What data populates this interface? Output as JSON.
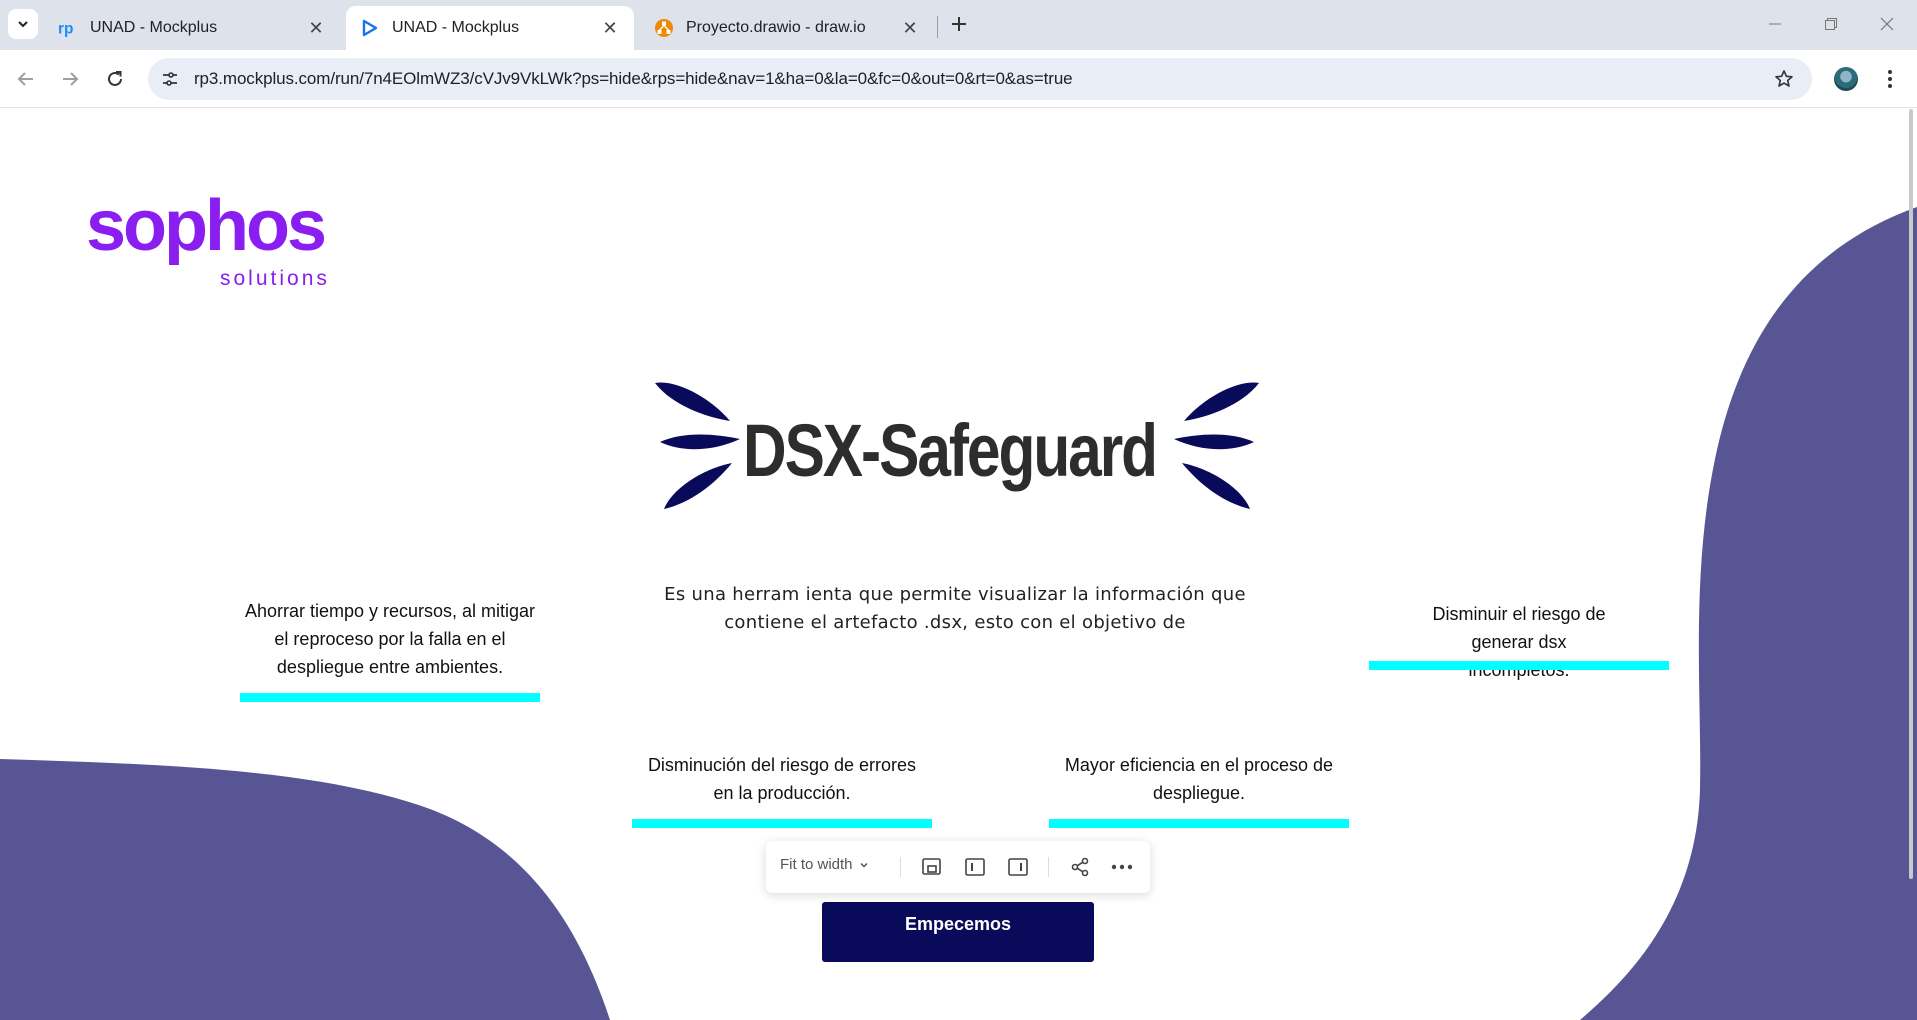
{
  "browser": {
    "tabs": [
      {
        "title": "UNAD - Mockplus",
        "icon": "mockplus-rp-icon",
        "active": false
      },
      {
        "title": "UNAD - Mockplus",
        "icon": "mockplus-play-icon",
        "active": true
      },
      {
        "title": "Proyecto.drawio - draw.io",
        "icon": "drawio-icon",
        "active": false
      }
    ],
    "url": "rp3.mockplus.com/run/7n4EOlmWZ3/cVJv9VkLWk?ps=hide&rps=hide&nav=1&ha=0&la=0&fc=0&out=0&rt=0&as=true"
  },
  "page": {
    "logo": {
      "word": "sophos",
      "sub": "solutions",
      "color": "#8a1df0"
    },
    "brand": {
      "name": "DSX-Safeguard",
      "mark_color": "#0a0a5a",
      "text_color": "#2d2d2d"
    },
    "intro": "Es una herram ienta que permite visualizar la información que contiene el artefacto .dsx, esto con el objetivo de",
    "benefits": [
      {
        "text": "Ahorrar tiempo y recursos, al mitigar el reproceso por la falla en el despliegue entre ambientes."
      },
      {
        "text": "Disminuir el riesgo de generar dsx incompletos."
      },
      {
        "text": "Disminución del riesgo de errores en la producción."
      },
      {
        "text": "Mayor eficiencia en el proceso de despliegue."
      }
    ],
    "cta": "Empecemos",
    "colors": {
      "accent_bar": "#00ffff",
      "blob": "#575594",
      "cta_bg": "#0a0a5a"
    }
  },
  "viewer": {
    "fit_label": "Fit to width",
    "buttons": [
      "fit-screen-icon",
      "left-panel-icon",
      "right-panel-icon",
      "share-icon",
      "more-icon"
    ]
  }
}
